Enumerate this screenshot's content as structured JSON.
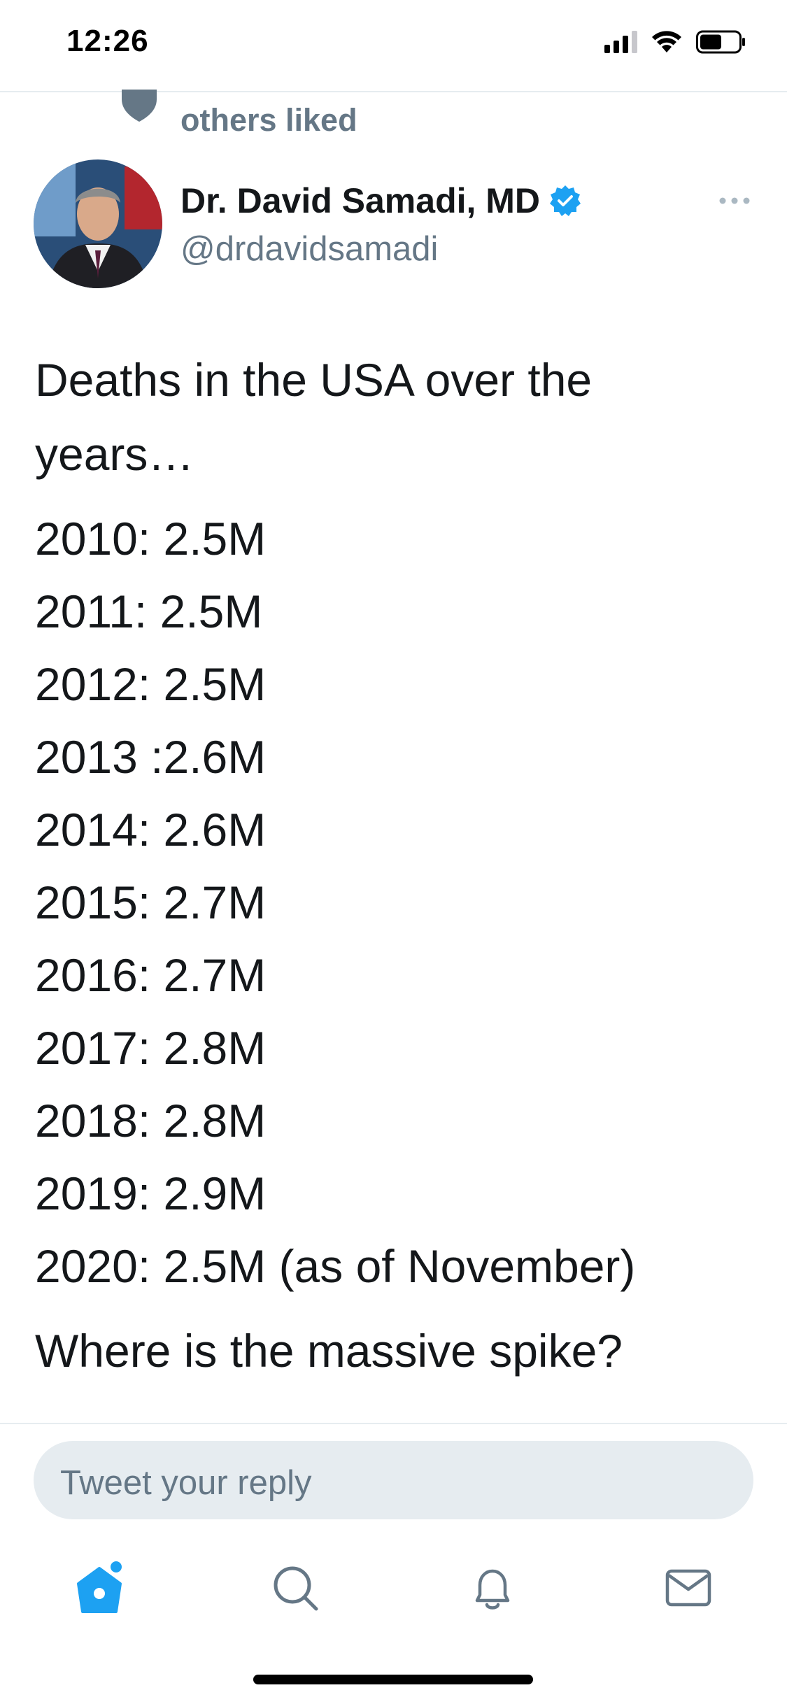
{
  "status_bar": {
    "time": "12:26"
  },
  "social_context": {
    "text": "others liked",
    "icon": "heart-icon"
  },
  "tweet": {
    "author": {
      "name": "Dr. David Samadi, MD",
      "handle": "@drdavidsamadi",
      "verified": true
    },
    "intro_line_1": "Deaths in the USA over the",
    "intro_line_2": "years…",
    "stats": [
      "2010: 2.5M",
      "2011: 2.5M",
      "2012: 2.5M",
      "2013 :2.6M",
      "2014: 2.6M",
      "2015: 2.7M",
      "2016: 2.7M",
      "2017: 2.8M",
      "2018: 2.8M",
      "2019: 2.9M",
      "2020: 2.5M (as of November)"
    ],
    "question": "Where is the massive spike?"
  },
  "reply": {
    "placeholder": "Tweet your reply"
  },
  "tab_bar": {
    "tabs": [
      "home-icon",
      "search-icon",
      "notifications-icon",
      "messages-icon"
    ]
  },
  "colors": {
    "accent": "#1da1f2",
    "text": "#14171a",
    "secondary_text": "#657786",
    "reply_box": "#e6ecf0"
  }
}
